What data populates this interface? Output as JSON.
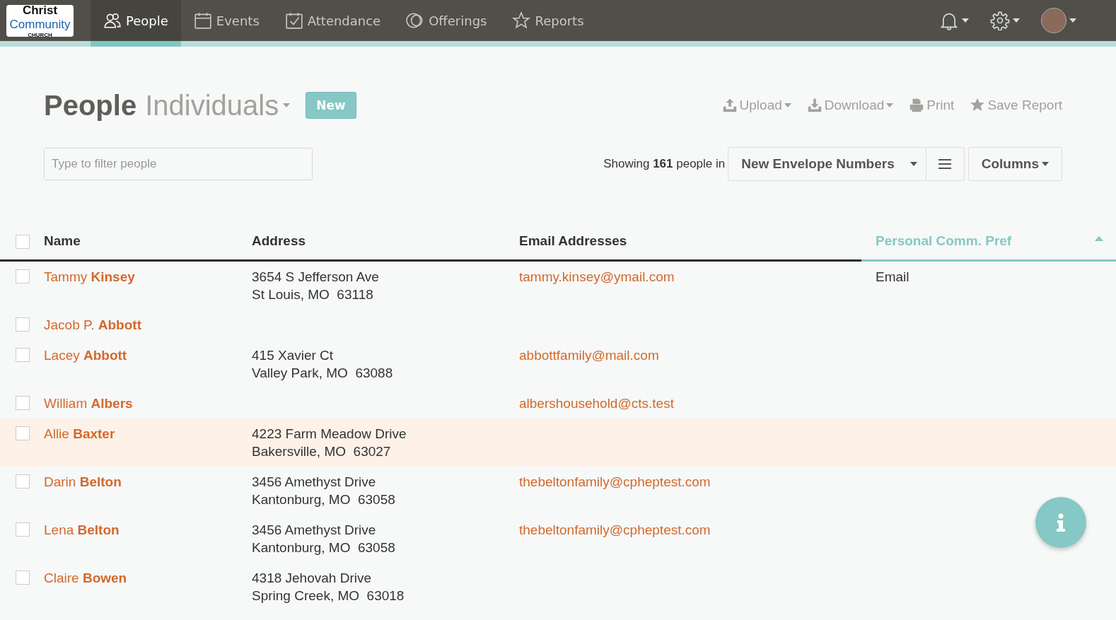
{
  "logo": {
    "lines": [
      "Christ",
      "Community",
      "CHURCH"
    ]
  },
  "nav": [
    {
      "label": "People",
      "selected": true
    },
    {
      "label": "Events",
      "selected": false
    },
    {
      "label": "Attendance",
      "selected": false
    },
    {
      "label": "Offerings",
      "selected": false
    },
    {
      "label": "Reports",
      "selected": false
    }
  ],
  "header": {
    "title": "People",
    "subtitle": "Individuals",
    "new_button": "New"
  },
  "actions": [
    {
      "label": "Upload",
      "dropdown": true
    },
    {
      "label": "Download",
      "dropdown": true
    },
    {
      "label": "Print",
      "dropdown": false
    },
    {
      "label": "Save Report",
      "dropdown": false
    }
  ],
  "filter": {
    "placeholder": "Type to filter people"
  },
  "summary": "Showing **161** people in",
  "list_select": "New Envelope Numbers",
  "columns_button": "Columns",
  "table": {
    "select_all_checked": false,
    "columns": [
      {
        "label": "Name",
        "sorted": false
      },
      {
        "label": "Address",
        "sorted": false
      },
      {
        "label": "Email Addresses",
        "sorted": false
      },
      {
        "label": "Personal Comm. Pref",
        "sorted": true
      }
    ],
    "rows": [
      {
        "name": "Tammy **Kinsey**",
        "address": [
          "3654 S Jefferson Ave",
          "St Louis, MO  63118"
        ],
        "email": "tammy.kinsey@ymail.com",
        "pref": "Email",
        "highlighted": false,
        "checked": false
      },
      {
        "name": "Jacob P. **Abbott**",
        "address": [],
        "email": "",
        "pref": "",
        "highlighted": false,
        "checked": false
      },
      {
        "name": "Lacey **Abbott**",
        "address": [
          "415 Xavier Ct",
          "Valley Park, MO  63088"
        ],
        "email": "abbottfamily@mail.com",
        "pref": "",
        "highlighted": false,
        "checked": false
      },
      {
        "name": "William **Albers**",
        "address": [],
        "email": "albershousehold@cts.test",
        "pref": "",
        "highlighted": false,
        "checked": false
      },
      {
        "name": "Allie **Baxter**",
        "address": [
          "4223 Farm Meadow Drive",
          "Bakersville, MO  63027"
        ],
        "email": "",
        "pref": "",
        "highlighted": true,
        "checked": false
      },
      {
        "name": "Darin **Belton**",
        "address": [
          "3456 Amethyst Drive",
          "Kantonburg, MO  63058"
        ],
        "email": "thebeltonfamily@cpheptest.com",
        "pref": "",
        "highlighted": false,
        "checked": false
      },
      {
        "name": "Lena **Belton**",
        "address": [
          "3456 Amethyst Drive",
          "Kantonburg, MO  63058"
        ],
        "email": "thebeltonfamily@cpheptest.com",
        "pref": "",
        "highlighted": false,
        "checked": false
      },
      {
        "name": "Claire **Bowen**",
        "address": [
          "4318 Jehovah Drive",
          "Spring Creek, MO  63018"
        ],
        "email": "",
        "pref": "",
        "highlighted": false,
        "checked": false
      }
    ]
  }
}
